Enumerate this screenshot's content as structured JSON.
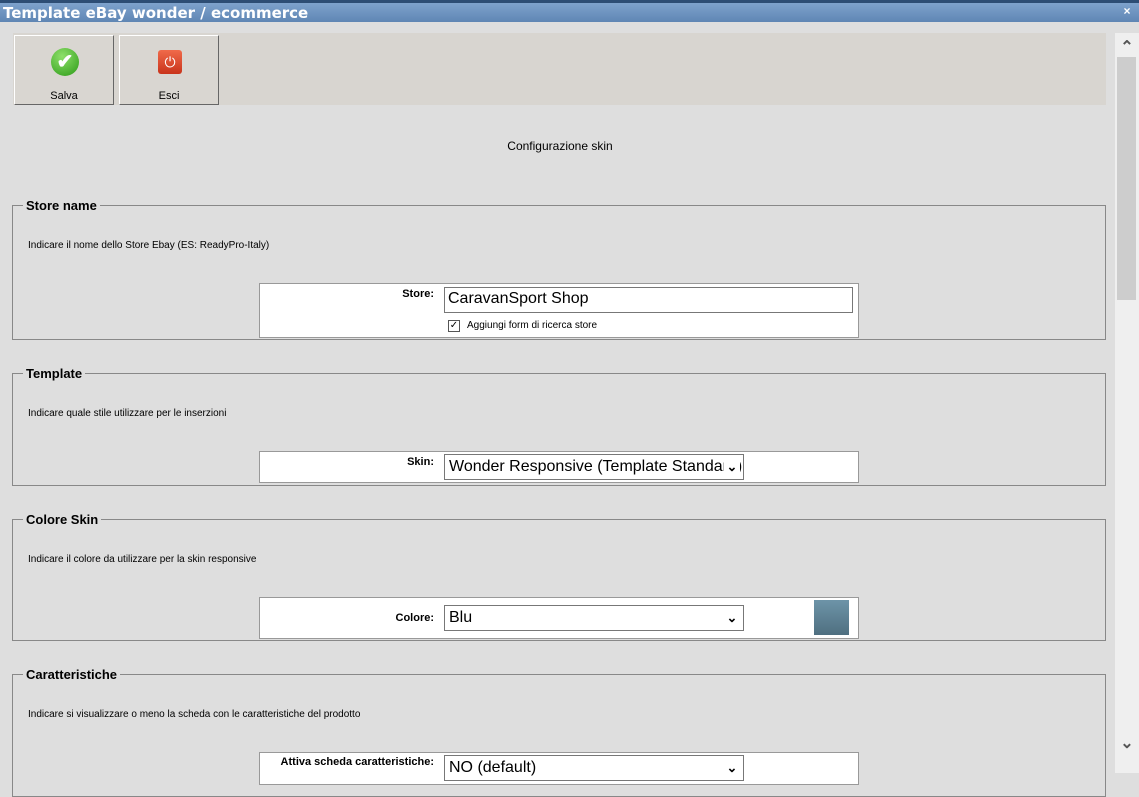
{
  "window": {
    "title": "Template eBay wonder / ecommerce",
    "close": "×"
  },
  "toolbar": {
    "save_label": "Salva",
    "save_icon": "✔",
    "exit_label": "Esci",
    "exit_icon": "⏻"
  },
  "page_heading": "Configurazione skin",
  "sections": [
    {
      "legend": "Store name",
      "desc": "Indicare il nome dello Store Ebay (ES: ReadyPro-Italy)",
      "label": "Store:",
      "value": "CaravanSport Shop",
      "checkbox_label": "Aggiungi form di ricerca store",
      "checkbox_mark": "✓"
    },
    {
      "legend": "Template",
      "desc": "Indicare quale stile utilizzare per le inserzioni",
      "label": "Skin:",
      "value": "Wonder Responsive (Template Standard)"
    },
    {
      "legend": "Colore Skin",
      "desc": "Indicare il colore da utilizzare per la skin responsive",
      "label": "Colore:",
      "value": "Blu",
      "swatch": "#5f8294"
    },
    {
      "legend": "Caratteristiche",
      "desc": "Indicare si visualizzare o meno la scheda con le caratteristiche del prodotto",
      "label": "Attiva scheda caratteristiche:",
      "value": "NO (default)"
    }
  ],
  "scroll": {
    "up": "⌃",
    "down": "⌄"
  }
}
